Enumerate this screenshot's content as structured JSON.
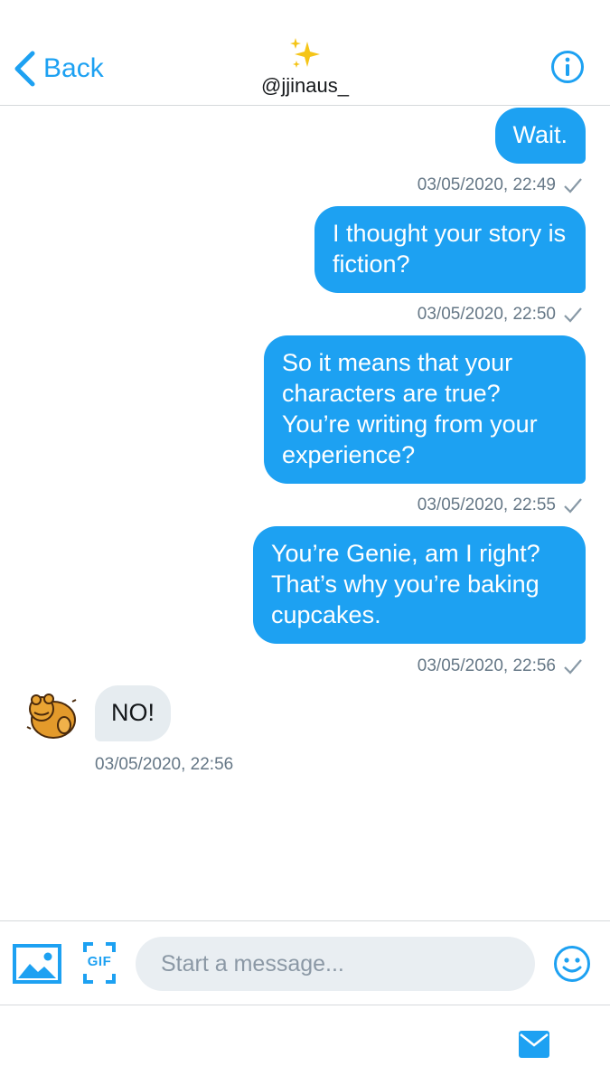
{
  "header": {
    "back_label": "Back",
    "sparkle_emoji": "sparkles",
    "handle": "@jjinaus_",
    "info_icon": "info-circle-icon",
    "accent_color": "#1da1f2"
  },
  "messages": [
    {
      "text": "Wait.",
      "timestamp": "03/05/2020, 22:49"
    },
    {
      "text": "I thought your story is fiction?",
      "timestamp": "03/05/2020, 22:50"
    },
    {
      "text": "So it means that your characters are true? You’re writing from your experience?",
      "timestamp": "03/05/2020, 22:55"
    },
    {
      "text": "You’re Genie, am I right? That’s why you’re baking cupcakes.",
      "timestamp": "03/05/2020, 22:56"
    },
    {
      "text": "NO!",
      "timestamp": "03/05/2020, 22:56"
    }
  ],
  "composer": {
    "placeholder": "Start a message...",
    "gif_label": "GIF",
    "media_icon": "image-icon",
    "emoji_icon": "smiley-icon"
  },
  "bottom_bar": {
    "icon": "mail-icon"
  }
}
